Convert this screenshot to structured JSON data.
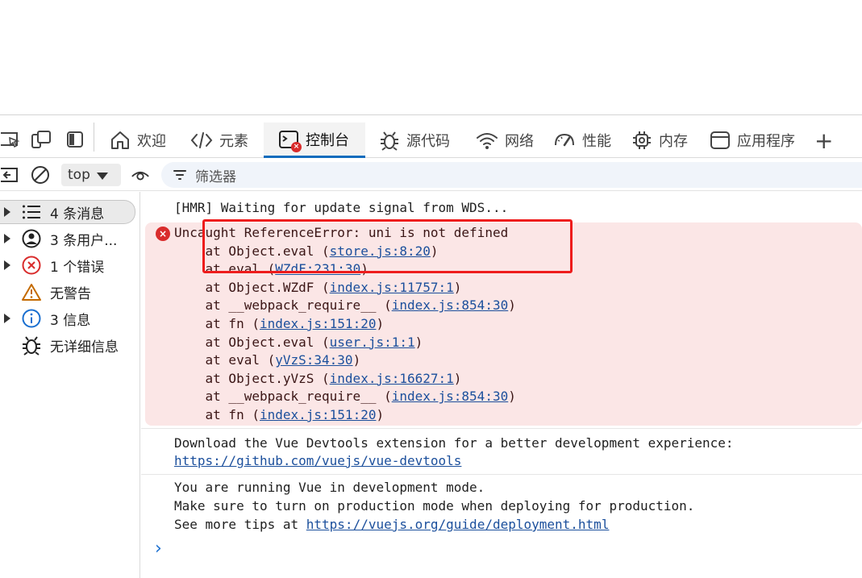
{
  "toolbar": {
    "tabs": [
      {
        "label": "欢迎",
        "icon": "home-icon"
      },
      {
        "label": "元素",
        "icon": "code-icon"
      },
      {
        "label": "控制台",
        "icon": "console-icon",
        "active": true
      },
      {
        "label": "源代码",
        "icon": "bug-icon"
      },
      {
        "label": "网络",
        "icon": "wifi-icon"
      },
      {
        "label": "性能",
        "icon": "gauge-icon"
      },
      {
        "label": "内存",
        "icon": "chip-icon"
      },
      {
        "label": "应用程序",
        "icon": "window-icon"
      }
    ],
    "add_tab_label": "+",
    "active_color": "#0f6cbd"
  },
  "filterbar": {
    "context": "top",
    "filter_label": "筛选器"
  },
  "sidebar": {
    "items": [
      {
        "label": "4 条消息",
        "icon": "list-icon"
      },
      {
        "label": "3 条用户...",
        "icon": "user-icon"
      },
      {
        "label": "1 个错误",
        "icon": "error-circle-icon"
      },
      {
        "label": "无警告",
        "icon": "warning-icon"
      },
      {
        "label": "3 信息",
        "icon": "info-icon"
      },
      {
        "label": "无详细信息",
        "icon": "bug-icon"
      }
    ]
  },
  "console": {
    "hmr_line": "[HMR] Waiting for update signal from WDS...",
    "error": {
      "message": "Uncaught ReferenceError: uni is not defined",
      "frames": [
        {
          "prefix": "    at Object.eval (",
          "link": "store.js:8:20",
          "suffix": ")"
        },
        {
          "prefix": "    at eval (",
          "link": "WZdF:231:30",
          "suffix": ")"
        },
        {
          "prefix": "    at Object.WZdF (",
          "link": "index.js:11757:1",
          "suffix": ")"
        },
        {
          "prefix": "    at __webpack_require__ (",
          "link": "index.js:854:30",
          "suffix": ")"
        },
        {
          "prefix": "    at fn (",
          "link": "index.js:151:20",
          "suffix": ")"
        },
        {
          "prefix": "    at Object.eval (",
          "link": "user.js:1:1",
          "suffix": ")"
        },
        {
          "prefix": "    at eval (",
          "link": "yVzS:34:30",
          "suffix": ")"
        },
        {
          "prefix": "    at Object.yVzS (",
          "link": "index.js:16627:1",
          "suffix": ")"
        },
        {
          "prefix": "    at __webpack_require__ (",
          "link": "index.js:854:30",
          "suffix": ")"
        },
        {
          "prefix": "    at fn (",
          "link": "index.js:151:20",
          "suffix": ")"
        }
      ],
      "background": "#fbe6e6"
    },
    "devtools_msg": "Download the Vue Devtools extension for a better development experience:",
    "devtools_link": "https://github.com/vuejs/vue-devtools",
    "vue_mode_1": "You are running Vue in development mode.",
    "vue_mode_2": "Make sure to turn on production mode when deploying for production.",
    "vue_mode_3_prefix": "See more tips at ",
    "vue_mode_3_link": "https://vuejs.org/guide/deployment.html",
    "prompt": "›"
  },
  "annotation": {
    "color": "#ee1c1c"
  }
}
